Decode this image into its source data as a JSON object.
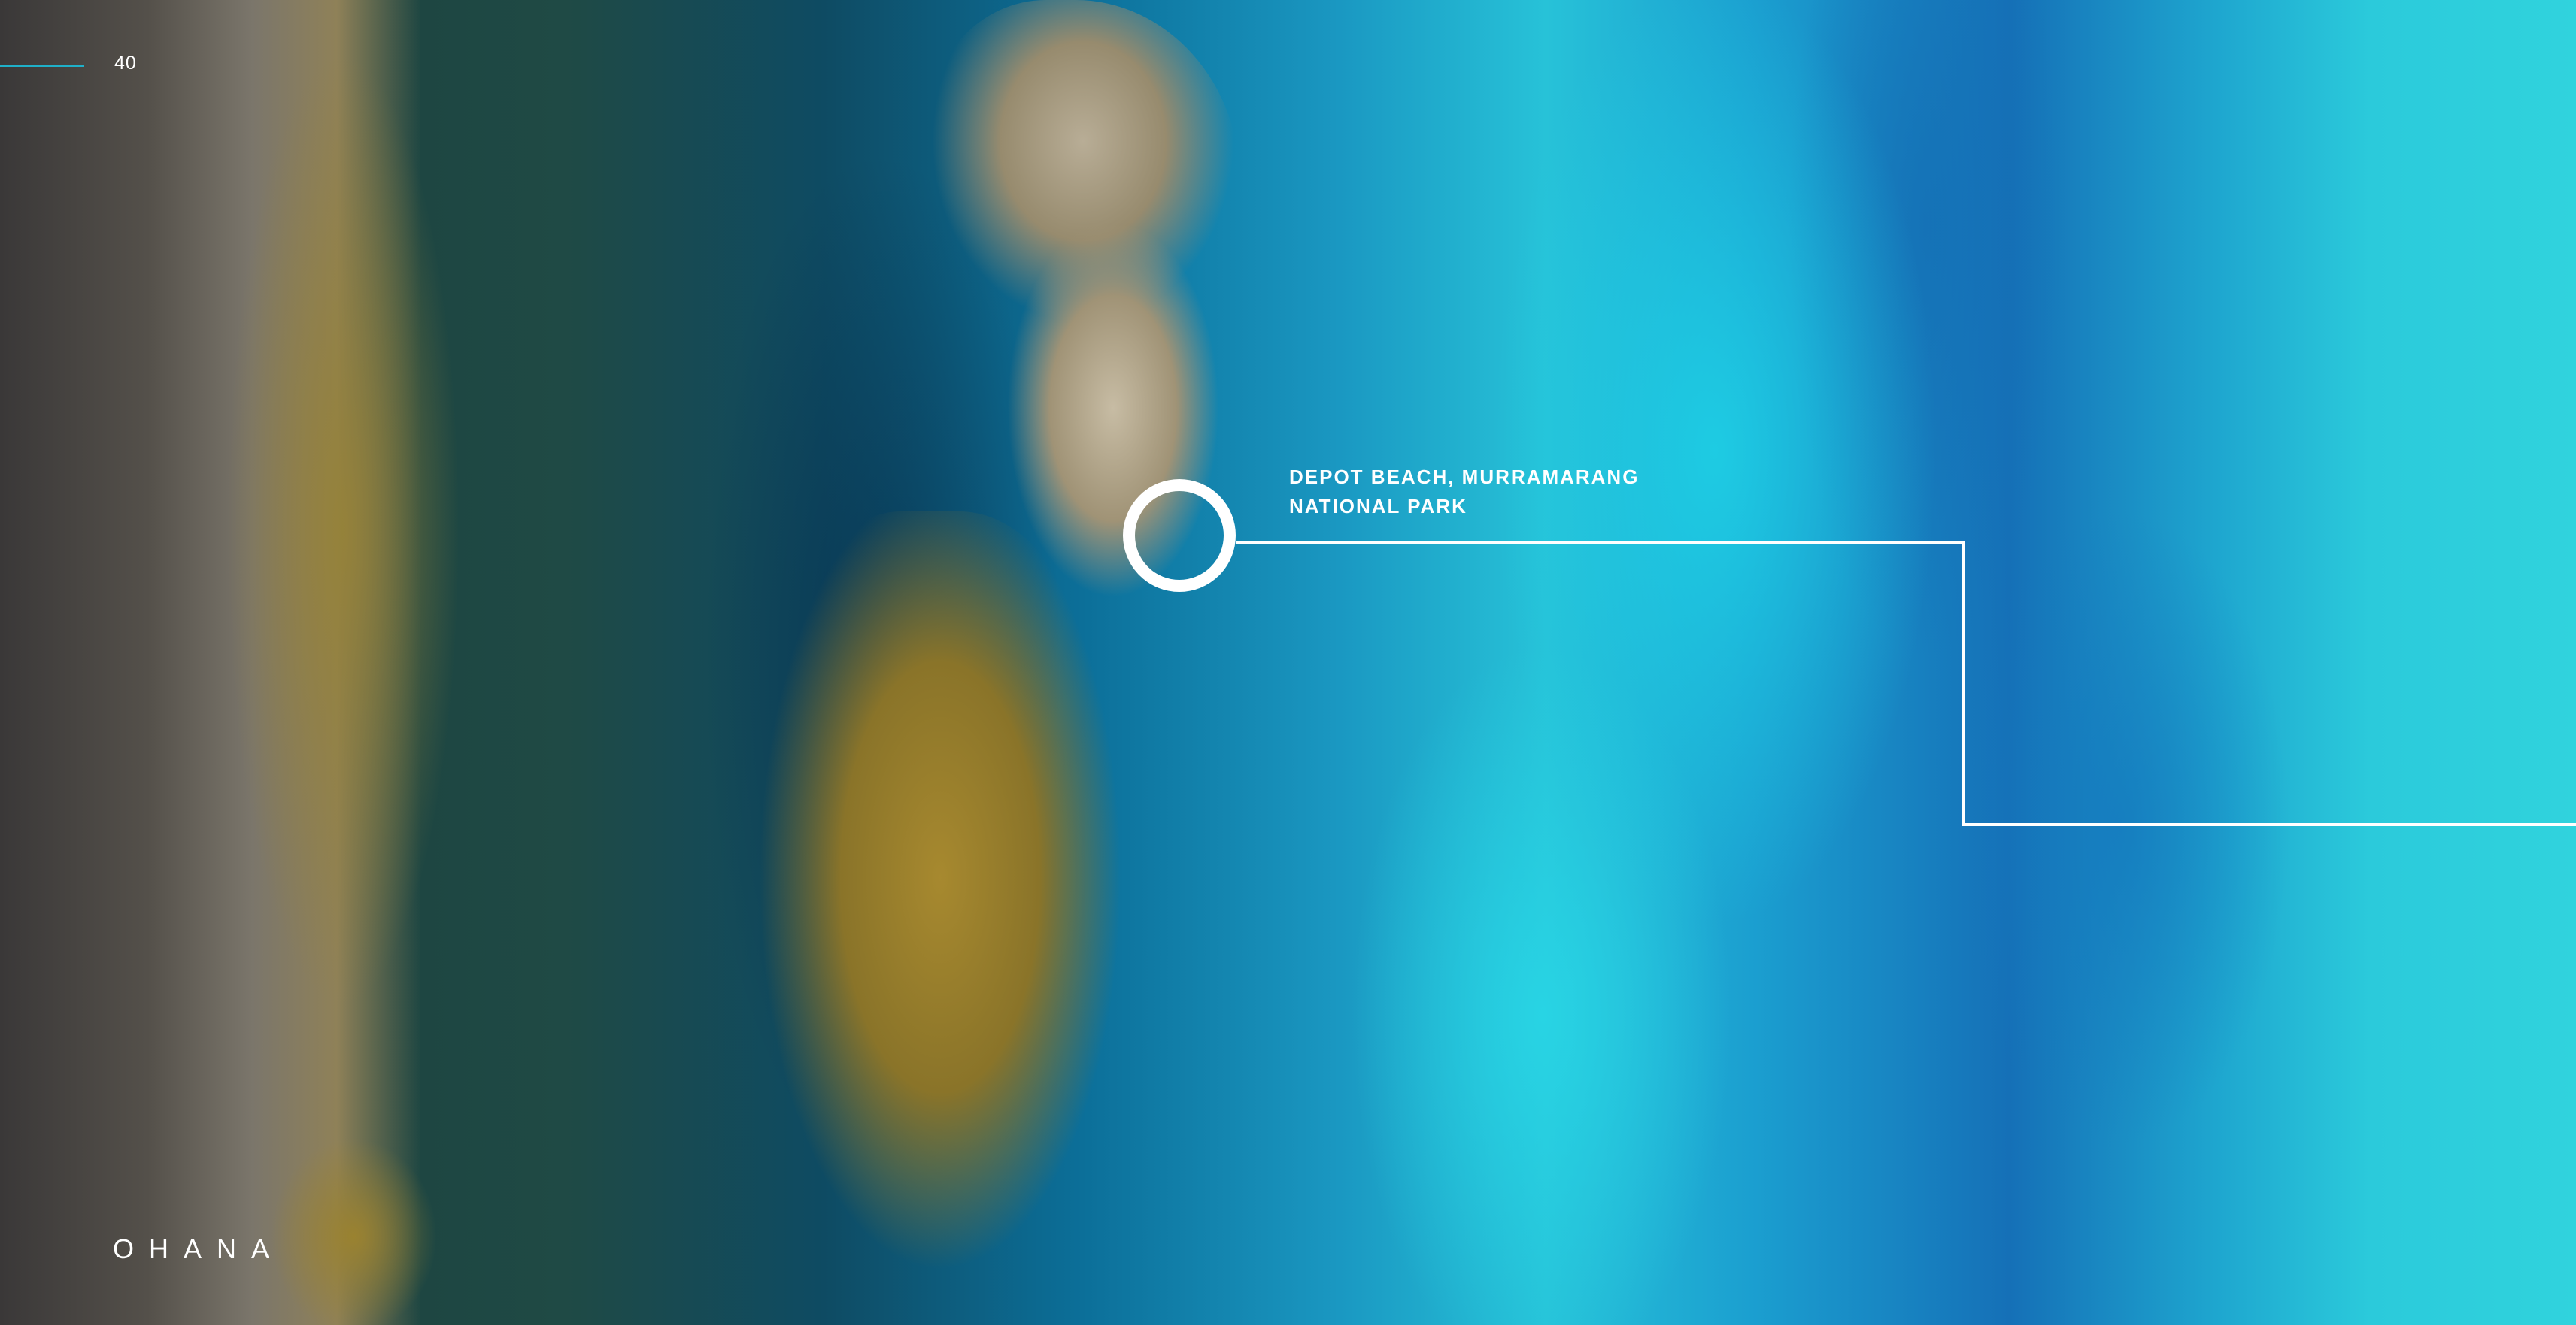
{
  "page": {
    "number": "40",
    "brand": "OHANA",
    "accent_color": "#1fb0c9"
  },
  "callout": {
    "caption_line1": "DEPOT BEACH, MURRAMARANG",
    "caption_line2": "NATIONAL PARK",
    "icon": "location-ring-icon",
    "color": "#ffffff"
  }
}
